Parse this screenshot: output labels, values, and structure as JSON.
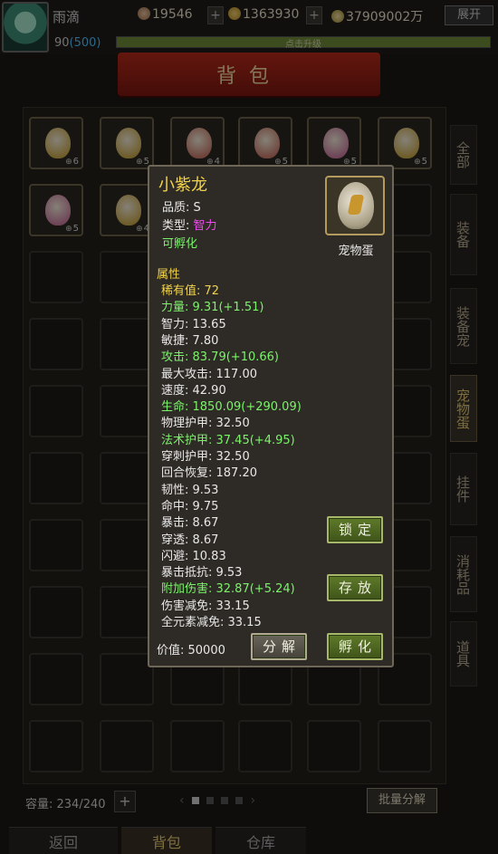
{
  "topbar": {
    "player_name": "雨滴",
    "resource1": "19546",
    "resource2": "1363930",
    "resource3": "37909002万",
    "plus": "+",
    "expand_label": "展开",
    "level": "90",
    "level_paren": "(500)",
    "xp_text": "点击升级"
  },
  "title": "背包",
  "inventory": {
    "items": [
      {
        "count": "6",
        "egg_color": "#c9a84a"
      },
      {
        "count": "5",
        "egg_color": "#c9a84a"
      },
      {
        "count": "4",
        "egg_color": "#c87a6a"
      },
      {
        "count": "5",
        "egg_color": "#c87a6a"
      },
      {
        "count": "5",
        "egg_color": "#c87aa0"
      },
      {
        "count": "5",
        "egg_color": "#c9a84a"
      },
      {
        "count": "5",
        "egg_color": "#c87aa0"
      },
      {
        "count": "4",
        "egg_color": "#c9a84a"
      }
    ],
    "capacity_label": "容量: 234/240",
    "capacity_plus": "+",
    "pager_left": "‹",
    "pager_right": "›",
    "batch_label": "批量分解"
  },
  "side_tabs": [
    "全部",
    "装备",
    "装备宠",
    "宠物蛋",
    "挂件",
    "消耗品",
    "道具"
  ],
  "side_tab_active": 3,
  "bottom_tabs": [
    "返回",
    "背包",
    "仓库"
  ],
  "popup": {
    "name": "小紫龙",
    "quality": "品质: S",
    "type_label": "类型: ",
    "type_value": "智力",
    "hatchable": "可孵化",
    "egg_label": "宠物蛋",
    "attr_title": "属性",
    "attributes": [
      {
        "text": "稀有值: 72",
        "style": "y"
      },
      {
        "text": "力量: 9.31(+1.51)",
        "style": "g"
      },
      {
        "text": "智力: 13.65",
        "style": ""
      },
      {
        "text": "敏捷: 7.80",
        "style": ""
      },
      {
        "text": "攻击: 83.79(+10.66)",
        "style": "g"
      },
      {
        "text": "最大攻击: 117.00",
        "style": ""
      },
      {
        "text": "速度: 42.90",
        "style": ""
      },
      {
        "text": "生命: 1850.09(+290.09)",
        "style": "g"
      },
      {
        "text": "物理护甲: 32.50",
        "style": ""
      },
      {
        "text": "法术护甲: 37.45(+4.95)",
        "style": "g"
      },
      {
        "text": "穿刺护甲: 32.50",
        "style": ""
      },
      {
        "text": "回合恢复: 187.20",
        "style": ""
      },
      {
        "text": "韧性: 9.53",
        "style": ""
      },
      {
        "text": "命中: 9.75",
        "style": ""
      },
      {
        "text": "暴击: 8.67",
        "style": ""
      },
      {
        "text": "穿透: 8.67",
        "style": ""
      },
      {
        "text": "闪避: 10.83",
        "style": ""
      },
      {
        "text": "暴击抵抗: 9.53",
        "style": ""
      },
      {
        "text": "附加伤害: 32.87(+5.24)",
        "style": "g"
      },
      {
        "text": "伤害减免: 33.15",
        "style": ""
      },
      {
        "text": "全元素减免: 33.15",
        "style": ""
      }
    ],
    "price": "价值: 50000",
    "lock_label": "锁定",
    "store_label": "存放",
    "decompose_label": "分解",
    "hatch_label": "孵化"
  }
}
